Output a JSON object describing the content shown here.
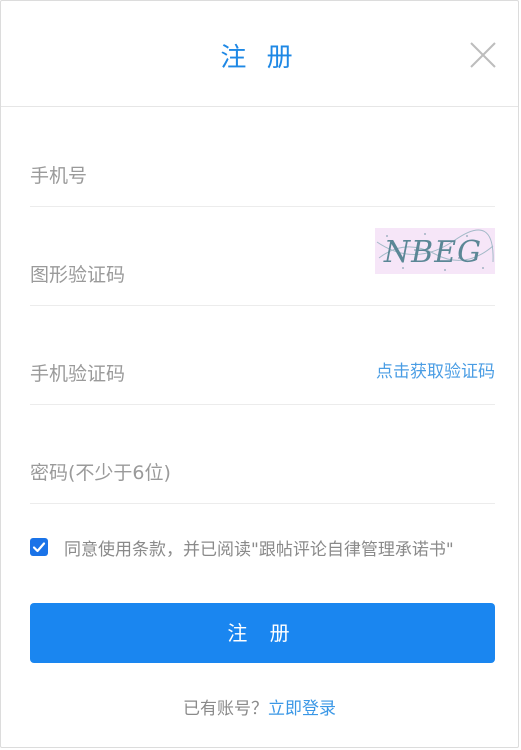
{
  "header": {
    "title": "注 册"
  },
  "fields": {
    "phone": {
      "placeholder": "手机号"
    },
    "captcha": {
      "placeholder": "图形验证码",
      "captcha_text": "NBEG"
    },
    "sms": {
      "placeholder": "手机验证码",
      "link": "点击获取验证码"
    },
    "password": {
      "placeholder": "密码(不少于6位)"
    }
  },
  "agreement": {
    "checked": true,
    "text": "同意使用条款，并已阅读\"跟帖评论自律管理承诺书\""
  },
  "submit": {
    "label": "注 册"
  },
  "footer": {
    "prompt": "已有账号？",
    "login_link": "立即登录"
  },
  "colors": {
    "accent": "#1a86f0",
    "title": "#1e88e5",
    "link": "#4a9de4"
  }
}
